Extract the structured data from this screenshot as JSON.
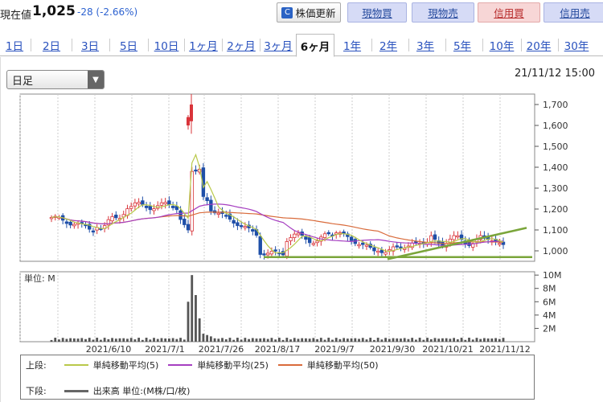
{
  "header": {
    "price_label": "現在値",
    "price_value": "1,025",
    "price_change": "-28 (-2.66%)",
    "buttons": {
      "update": "株価更新",
      "spot_buy": "現物買",
      "spot_sell": "現物売",
      "margin_buy": "信用買",
      "margin_sell": "信用売"
    }
  },
  "tabs": [
    "1日",
    "2日",
    "3日",
    "5日",
    "10日",
    "1ヶ月",
    "2ヶ月",
    "3ヶ月",
    "6ヶ月",
    "1年",
    "2年",
    "3年",
    "5年",
    "10年",
    "20年",
    "30年"
  ],
  "active_tab": "6ヶ月",
  "toolbar": {
    "period_select": "日足",
    "datetime": "21/11/12 15:00"
  },
  "chart_data": [
    {
      "type": "candlestick",
      "title": "",
      "y_ticks": [
        "1,000",
        "1,100",
        "1,200",
        "1,300",
        "1,400",
        "1,500",
        "1,600",
        "1,700"
      ],
      "ylim": [
        950,
        1750
      ],
      "x_ticks": [
        "2021/6/10",
        "2021/7/1",
        "2021/7/26",
        "2021/8/17",
        "2021/9/7",
        "2021/9/30",
        "2021/10/21",
        "2021/11/12"
      ],
      "series": [
        {
          "name": "単純移動平均(5)",
          "color": "#b9c94a"
        },
        {
          "name": "単純移動平均(25)",
          "color": "#a63fc1"
        },
        {
          "name": "単純移動平均(50)",
          "color": "#d96b3b"
        }
      ],
      "trend_lines_color": "#7aa53a"
    },
    {
      "type": "bar",
      "title": "",
      "unit_label": "単位: M",
      "y_ticks": [
        "2M",
        "4M",
        "6M",
        "8M",
        "10M"
      ],
      "ylim": [
        0,
        10.5
      ]
    }
  ],
  "legend": {
    "upper_label": "上段:",
    "lower_label": "下段:",
    "ma5": "単純移動平均(5)",
    "ma25": "単純移動平均(25)",
    "ma50": "単純移動平均(50)",
    "volume": "出来高 単位:(M株/口/枚)",
    "colors": {
      "ma5": "#b9c94a",
      "ma25": "#a63fc1",
      "ma50": "#d96b3b",
      "volume": "#666666"
    }
  }
}
